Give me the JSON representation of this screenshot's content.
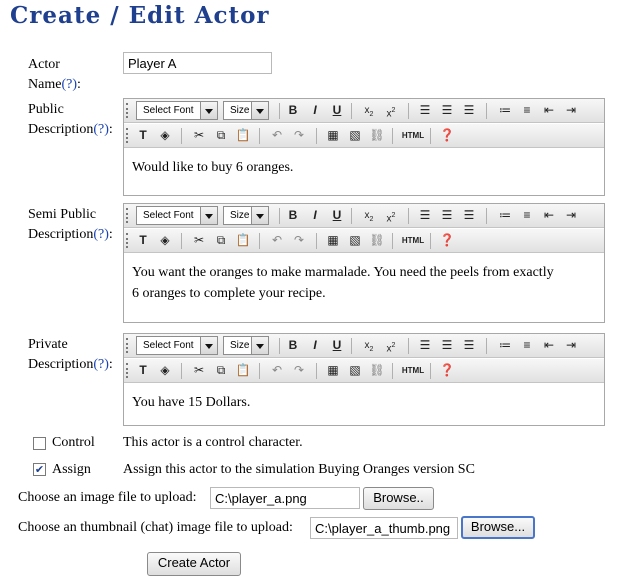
{
  "page_title": "Create / Edit Actor",
  "help_mark": "(?)",
  "actor_name": {
    "label_line1": "Actor",
    "label_line2": "Name",
    "value": "Player A"
  },
  "toolbar": {
    "font_select": "Select Font",
    "size_select": "Size",
    "bold": "B",
    "italic": "I",
    "underline": "U",
    "html": "HTML"
  },
  "public": {
    "label_line1": "Public",
    "label_line2": "Description",
    "content": "Would like to buy 6 oranges."
  },
  "semi": {
    "label_line1": "Semi Public",
    "label_line2": "Description",
    "content_line1": "You want the oranges to make marmalade. You need the peels from exactly",
    "content_line2": "6 oranges to complete your recipe."
  },
  "private": {
    "label_line1": "Private",
    "label_line2": "Description",
    "content": "You have 15 Dollars."
  },
  "control": {
    "label": "Control",
    "checked": false,
    "description": "This actor is a control character."
  },
  "assign": {
    "label": "Assign",
    "checked": true,
    "description": "Assign this actor to the simulation Buying Oranges version SC"
  },
  "image_upload": {
    "label": "Choose an image file to upload:",
    "value": "C:\\player_a.png",
    "button": "Browse.."
  },
  "thumb_upload": {
    "label": "Choose an thumbnail (chat) image file to upload:",
    "value": "C:\\player_a_thumb.png",
    "button": "Browse..."
  },
  "submit_label": "Create Actor"
}
